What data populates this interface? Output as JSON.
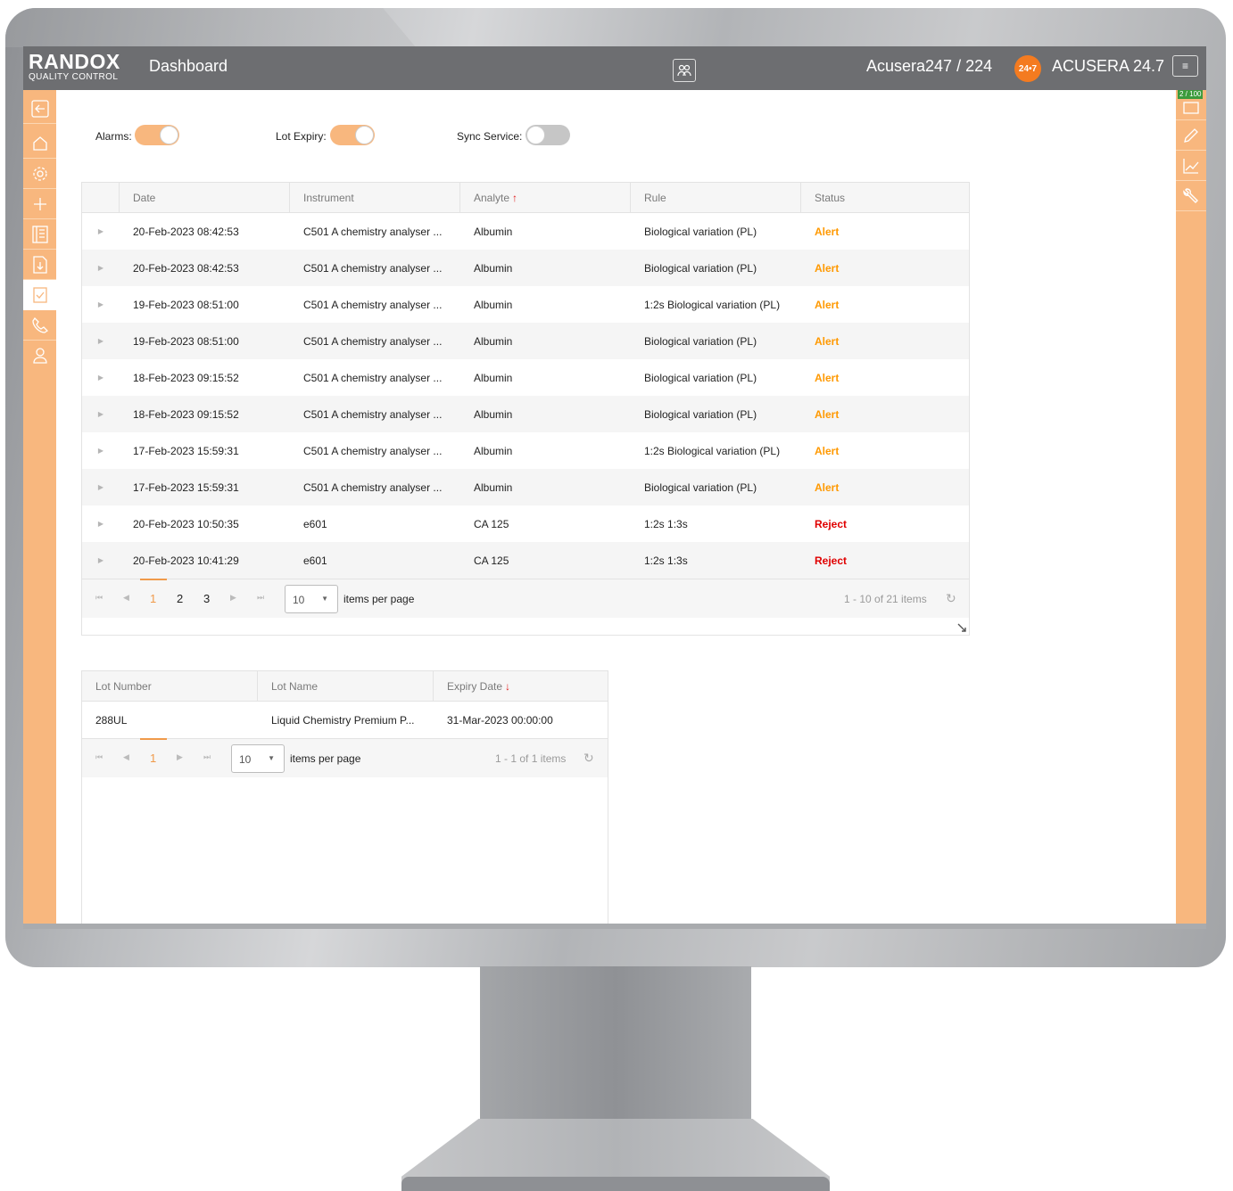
{
  "header": {
    "brand_main": "RANDOX",
    "brand_sub": "QUALITY CONTROL",
    "page_title": "Dashboard",
    "user": "Acusera247 / 224",
    "logo_badge": "24•7",
    "product": "ACUSERA 24.7",
    "menu_icon": "≡"
  },
  "right_sidebar": {
    "counter": "2 / 100"
  },
  "toggles": {
    "alarms": {
      "label": "Alarms:",
      "on": true
    },
    "lot_expiry": {
      "label": "Lot Expiry:",
      "on": true
    },
    "sync_service": {
      "label": "Sync Service:",
      "on": false
    }
  },
  "alerts_grid": {
    "columns": [
      "Date",
      "Instrument",
      "Analyte",
      "Rule",
      "Status"
    ],
    "sort_icon": "↑",
    "rows": [
      {
        "date": "20-Feb-2023 08:42:53",
        "instrument": "C501 A chemistry analyser ...",
        "analyte": "Albumin",
        "rule": "Biological variation (PL)",
        "status": "Alert"
      },
      {
        "date": "20-Feb-2023 08:42:53",
        "instrument": "C501 A chemistry analyser ...",
        "analyte": "Albumin",
        "rule": "Biological variation (PL)",
        "status": "Alert"
      },
      {
        "date": "19-Feb-2023 08:51:00",
        "instrument": "C501 A chemistry analyser ...",
        "analyte": "Albumin",
        "rule": "1:2s Biological variation (PL)",
        "status": "Alert"
      },
      {
        "date": "19-Feb-2023 08:51:00",
        "instrument": "C501 A chemistry analyser ...",
        "analyte": "Albumin",
        "rule": "Biological variation (PL)",
        "status": "Alert"
      },
      {
        "date": "18-Feb-2023 09:15:52",
        "instrument": "C501 A chemistry analyser ...",
        "analyte": "Albumin",
        "rule": "Biological variation (PL)",
        "status": "Alert"
      },
      {
        "date": "18-Feb-2023 09:15:52",
        "instrument": "C501 A chemistry analyser ...",
        "analyte": "Albumin",
        "rule": "Biological variation (PL)",
        "status": "Alert"
      },
      {
        "date": "17-Feb-2023 15:59:31",
        "instrument": "C501 A chemistry analyser ...",
        "analyte": "Albumin",
        "rule": "1:2s Biological variation (PL)",
        "status": "Alert"
      },
      {
        "date": "17-Feb-2023 15:59:31",
        "instrument": "C501 A chemistry analyser ...",
        "analyte": "Albumin",
        "rule": "Biological variation (PL)",
        "status": "Alert"
      },
      {
        "date": "20-Feb-2023 10:50:35",
        "instrument": "e601",
        "analyte": "CA 125",
        "rule": "1:2s 1:3s",
        "status": "Reject"
      },
      {
        "date": "20-Feb-2023 10:41:29",
        "instrument": "e601",
        "analyte": "CA 125",
        "rule": "1:2s 1:3s",
        "status": "Reject"
      }
    ],
    "pager": {
      "pages": [
        "1",
        "2",
        "3"
      ],
      "current_page": "1",
      "page_size": "10",
      "page_size_label": "items per page",
      "info": "1 - 10 of 21 items"
    }
  },
  "lots_grid": {
    "columns": [
      "Lot Number",
      "Lot Name",
      "Expiry Date"
    ],
    "sort_icon": "↓",
    "rows": [
      {
        "lot_number": "288UL",
        "lot_name": "Liquid Chemistry Premium P...",
        "expiry": "31-Mar-2023 00:00:00"
      }
    ],
    "pager": {
      "pages": [
        "1"
      ],
      "current_page": "1",
      "page_size": "10",
      "page_size_label": "items per page",
      "info": "1 - 1 of 1 items"
    }
  },
  "colors": {
    "accent": "#f8b77e",
    "topbar": "#6d6e71",
    "alert": "#ff9900",
    "reject": "#e00000"
  }
}
